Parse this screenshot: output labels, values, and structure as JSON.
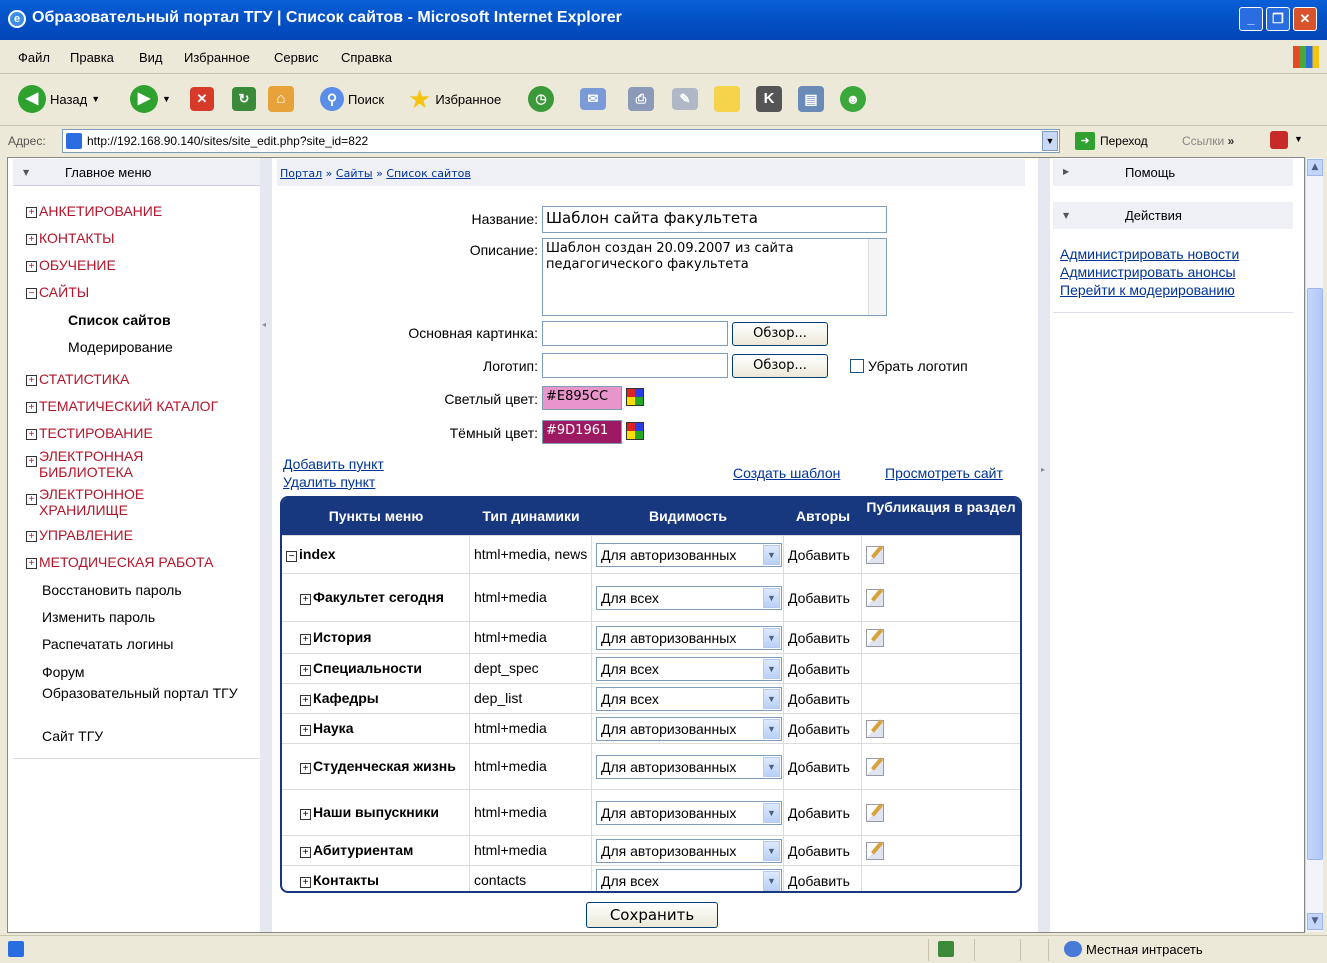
{
  "window": {
    "title": "Образовательный портал ТГУ | Список сайтов - Microsoft Internet Explorer"
  },
  "menubar": [
    "Файл",
    "Правка",
    "Вид",
    "Избранное",
    "Сервис",
    "Справка"
  ],
  "toolbar": {
    "back": "Назад",
    "search": "Поиск",
    "favorites": "Избранное"
  },
  "address": {
    "label": "Адрес:",
    "url": "http://192.168.90.140/sites/site_edit.php?site_id=822",
    "go": "Переход",
    "links": "Ссылки"
  },
  "left": {
    "header": "Главное меню",
    "items": [
      {
        "label": "АНКЕТИРОВАНИЕ"
      },
      {
        "label": "КОНТАКТЫ"
      },
      {
        "label": "ОБУЧЕНИЕ"
      },
      {
        "label": "САЙТЫ"
      },
      {
        "label": "Список сайтов"
      },
      {
        "label": "Модерирование"
      },
      {
        "label": "СТАТИСТИКА"
      },
      {
        "label": "ТЕМАТИЧЕСКИЙ КАТАЛОГ"
      },
      {
        "label": "ТЕСТИРОВАНИЕ"
      },
      {
        "label": "ЭЛЕКТРОННАЯ БИБЛИОТЕКА"
      },
      {
        "label": "ЭЛЕКТРОННОЕ ХРАНИЛИЩЕ"
      },
      {
        "label": "УПРАВЛЕНИЕ"
      },
      {
        "label": "МЕТОДИЧЕСКАЯ РАБОТА"
      },
      {
        "label": "Восстановить пароль"
      },
      {
        "label": "Изменить пароль"
      },
      {
        "label": "Распечатать логины"
      },
      {
        "label": "Форум"
      },
      {
        "label": "Образовательный портал ТГУ"
      },
      {
        "label": "Сайт ТГУ"
      }
    ]
  },
  "breadcrumb": {
    "portal": "Портал",
    "sites": "Сайты",
    "list": "Список сайтов",
    "sep": "»"
  },
  "form": {
    "name_label": "Название:",
    "name_value": "Шаблон сайта факультета",
    "desc_label": "Описание:",
    "desc_value": "Шаблон создан 20.09.2007 из сайта педагогического факультета",
    "image_label": "Основная картинка:",
    "logo_label": "Логотип:",
    "browse": "Обзор...",
    "remove_logo": "Убрать логотип",
    "light_label": "Светлый цвет:",
    "light_value": "#E895CC",
    "dark_label": "Тёмный цвет:",
    "dark_value": "#9D1961"
  },
  "links": {
    "add": "Добавить пункт",
    "delete": "Удалить пункт",
    "template": "Создать шаблон",
    "view": "Просмотреть сайт"
  },
  "table": {
    "headers": [
      "Пункты меню",
      "Тип динамики",
      "Видимость",
      "Авторы",
      "Публикация в раздел"
    ],
    "rows": [
      {
        "name": "index",
        "type": "html+media, news",
        "vis": "Для авторизованных",
        "author": "Добавить",
        "pub": true
      },
      {
        "name": "Факультет сегодня",
        "type": "html+media",
        "vis": "Для всех",
        "author": "Добавить",
        "pub": true
      },
      {
        "name": "История",
        "type": "html+media",
        "vis": "Для авторизованных",
        "author": "Добавить",
        "pub": true
      },
      {
        "name": "Специальности",
        "type": "dept_spec",
        "vis": "Для всех",
        "author": "Добавить",
        "pub": false
      },
      {
        "name": "Кафедры",
        "type": "dep_list",
        "vis": "Для всех",
        "author": "Добавить",
        "pub": false
      },
      {
        "name": "Наука",
        "type": "html+media",
        "vis": "Для авторизованных",
        "author": "Добавить",
        "pub": true
      },
      {
        "name": "Студенческая жизнь",
        "type": "html+media",
        "vis": "Для авторизованных",
        "author": "Добавить",
        "pub": true
      },
      {
        "name": "Наши выпускники",
        "type": "html+media",
        "vis": "Для авторизованных",
        "author": "Добавить",
        "pub": true
      },
      {
        "name": "Абитуриентам",
        "type": "html+media",
        "vis": "Для авторизованных",
        "author": "Добавить",
        "pub": true
      },
      {
        "name": "Контакты",
        "type": "contacts",
        "vis": "Для всех",
        "author": "Добавить",
        "pub": false
      }
    ]
  },
  "save": "Сохранить",
  "right": {
    "help": "Помощь",
    "actions": "Действия",
    "links": [
      "Администрировать новости",
      "Администрировать анонсы",
      "Перейти к модерированию"
    ]
  },
  "status": {
    "zone": "Местная интрасеть"
  },
  "colors": {
    "light": "#E895CC",
    "dark": "#9D1961",
    "table_header": "#17377f",
    "menu_red": "#b5142a",
    "link": "#003399"
  }
}
